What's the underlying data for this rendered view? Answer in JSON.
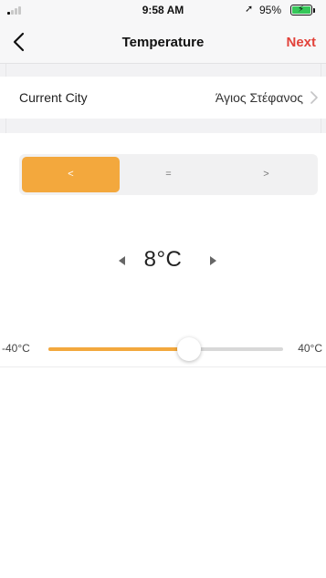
{
  "status_bar": {
    "time": "9:58 AM",
    "battery": "95%",
    "location_icon": "location-arrow-icon",
    "battery_charging": true
  },
  "nav": {
    "title": "Temperature",
    "back_icon": "chevron-left-icon",
    "next_label": "Next",
    "next_color": "#e2423a"
  },
  "city": {
    "label": "Current City",
    "value": "Άγιος Στέφανος",
    "chevron_icon": "chevron-right-icon"
  },
  "comparison": {
    "options": [
      "<",
      "=",
      ">"
    ],
    "selected_index": 0,
    "accent": "#f3a83d"
  },
  "temperature": {
    "display": "8°C",
    "value": 8,
    "min": -40,
    "max": 40,
    "min_label": "-40°C",
    "max_label": "40°C"
  }
}
